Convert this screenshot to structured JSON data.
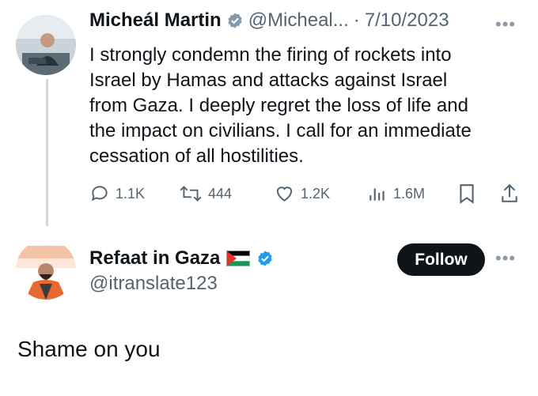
{
  "tweet": {
    "author_name": "Micheál Martin",
    "handle": "@Micheal...",
    "separator": "·",
    "date": "7/10/2023",
    "text": "I strongly condemn the firing of rockets into\nIsrael by Hamas and attacks against Israel\nfrom Gaza. I deeply regret the loss of life and\nthe impact on civilians. I call for an immediate\ncessation of all hostilities.",
    "actions": {
      "replies": "1.1K",
      "retweets": "444",
      "likes": "1.2K",
      "views": "1.6M"
    },
    "icons": [
      "verified-badge-gray",
      "more-icon",
      "reply-icon",
      "retweet-icon",
      "like-icon",
      "views-icon",
      "bookmark-icon",
      "share-icon"
    ]
  },
  "reply": {
    "author_name": "Refaat in Gaza",
    "flag": "🇵🇸",
    "handle": "@itranslate123",
    "follow_label": "Follow",
    "text": "Shame on you",
    "icons": [
      "palestine-flag-icon",
      "verified-badge-blue",
      "more-icon"
    ]
  },
  "colors": {
    "text": "#0f1419",
    "muted": "#536471",
    "verified_blue": "#1d9bf0",
    "verified_gray": "#829aab",
    "follow_bg": "#0f1419"
  }
}
